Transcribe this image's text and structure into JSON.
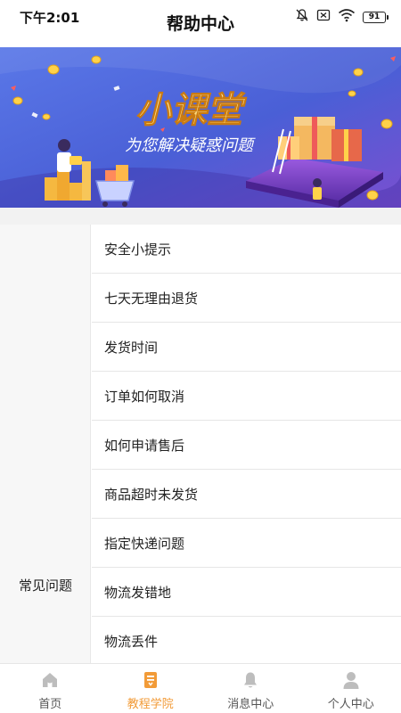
{
  "status_bar": {
    "time": "下午2:01",
    "battery": "91"
  },
  "header": {
    "title": "帮助中心"
  },
  "banner": {
    "title": "小课堂",
    "subtitle": "为您解决疑惑问题"
  },
  "sidebar": {
    "category": "常见问题"
  },
  "faq": {
    "items": [
      "安全小提示",
      "七天无理由退货",
      "发货时间",
      "订单如何取消",
      "如何申请售后",
      "商品超时未发货",
      "指定快递问题",
      "物流发错地",
      "物流丢件"
    ]
  },
  "tabbar": {
    "tabs": [
      {
        "label": "首页",
        "icon": "home-icon",
        "active": false
      },
      {
        "label": "教程学院",
        "icon": "book-icon",
        "active": true
      },
      {
        "label": "消息中心",
        "icon": "bell-icon",
        "active": false
      },
      {
        "label": "个人中心",
        "icon": "user-icon",
        "active": false
      }
    ]
  },
  "colors": {
    "accent": "#f29b38",
    "inactive_icon": "#bdbdbd",
    "banner_bg": "#4a5fd6"
  }
}
